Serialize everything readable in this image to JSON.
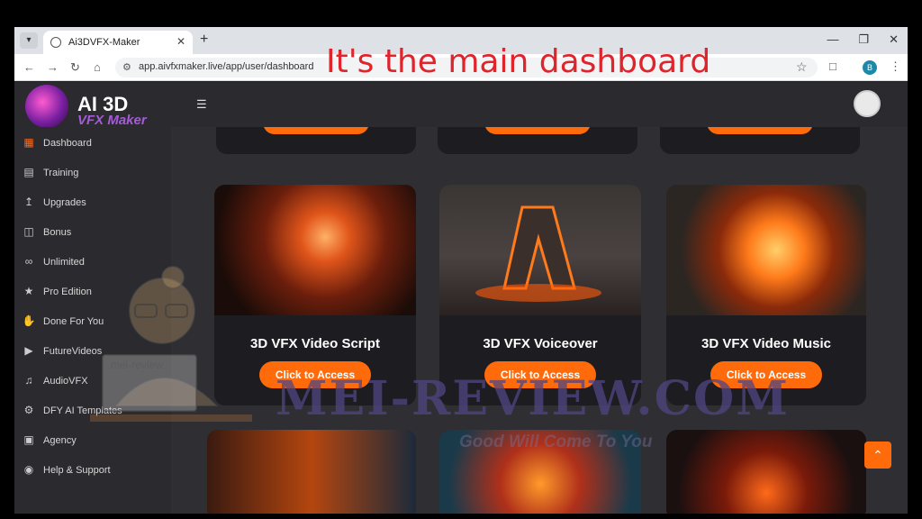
{
  "browser": {
    "tab_title": "Ai3DVFX-Maker",
    "url": "app.aivfxmaker.live/app/user/dashboard",
    "profile_initial": "B"
  },
  "caption": "It's the main dashboard",
  "app": {
    "logo_line1": "AI 3D",
    "logo_line2": "VFX Maker"
  },
  "sidebar": {
    "items": [
      {
        "label": "Dashboard",
        "icon": "grid-icon"
      },
      {
        "label": "Training",
        "icon": "training-icon"
      },
      {
        "label": "Upgrades",
        "icon": "upload-icon"
      },
      {
        "label": "Bonus",
        "icon": "gift-icon"
      },
      {
        "label": "Unlimited",
        "icon": "infinity-icon"
      },
      {
        "label": "Pro Edition",
        "icon": "star-icon"
      },
      {
        "label": "Done For You",
        "icon": "hand-icon"
      },
      {
        "label": "FutureVideos",
        "icon": "video-icon"
      },
      {
        "label": "AudioVFX",
        "icon": "music-icon"
      },
      {
        "label": "DFY AI Templates",
        "icon": "robot-icon"
      },
      {
        "label": "Agency",
        "icon": "briefcase-icon"
      },
      {
        "label": "Help & Support",
        "icon": "support-icon"
      }
    ]
  },
  "cards": {
    "top_button": "Click to Access",
    "items": [
      {
        "title": "3D VFX Video Script",
        "button": "Click to Access"
      },
      {
        "title": "3D VFX Voiceover",
        "button": "Click to Access"
      },
      {
        "title": "3D VFX Video Music",
        "button": "Click to Access"
      }
    ]
  },
  "watermark": {
    "main": "MEI-REVIEW.COM",
    "sub": "Good Will Come To You",
    "laptop": "mei-review"
  },
  "colors": {
    "accent": "#ff6a0a",
    "caption": "#e0242c",
    "bg": "#2f2f33"
  }
}
